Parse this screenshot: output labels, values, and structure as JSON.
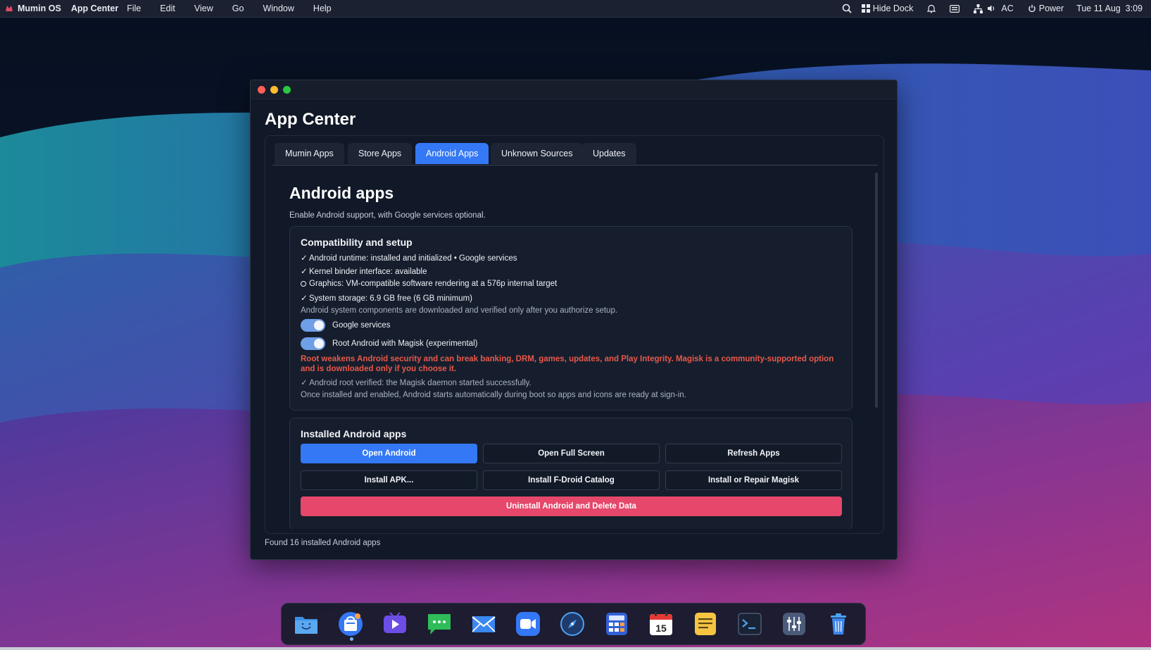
{
  "menubar": {
    "os_name": "Mumin OS",
    "app_name": "App Center",
    "menus": [
      "File",
      "Edit",
      "View",
      "Go",
      "Window",
      "Help"
    ],
    "hide_dock_label": "Hide Dock",
    "audio_label": "AC",
    "power_label": "Power",
    "datetime": "Tue 11 Aug  3:09"
  },
  "window": {
    "title": "App Center",
    "tabs": [
      {
        "label": "Mumin Apps",
        "active": false
      },
      {
        "label": "Store Apps",
        "active": false
      },
      {
        "label": "Android Apps",
        "active": true
      },
      {
        "label": "Unknown Sources",
        "active": false
      },
      {
        "label": "Updates",
        "active": false
      }
    ],
    "section_title": "Android apps",
    "section_subtitle": "Enable Android support, with Google services optional.",
    "compat": {
      "title": "Compatibility and setup",
      "checks": [
        {
          "mark": "✓",
          "text": "Android runtime: installed and initialized • Google services"
        },
        {
          "mark": "✓",
          "text": "Kernel binder interface: available"
        },
        {
          "mark": "circle",
          "text": "Graphics: VM-compatible software rendering at a 576p internal target"
        },
        {
          "mark": "✓",
          "text": "System storage: 6.9 GB free (6 GB minimum)"
        }
      ],
      "note": "Android system components are downloaded and verified only after you authorize setup.",
      "toggle_google": {
        "label": "Google services",
        "on": true
      },
      "toggle_root": {
        "label": "Root Android with Magisk (experimental)",
        "on": true
      },
      "warning": "Root weakens Android security and can break banking, DRM, games, updates, and Play Integrity. Magisk is a community-supported option and is downloaded only if you choose it.",
      "root_verified": "✓ Android root verified: the Magisk daemon started successfully.",
      "boot_note": "Once installed and enabled, Android starts automatically during boot so apps and icons are ready at sign-in."
    },
    "installed": {
      "title": "Installed Android apps",
      "open_android": "Open Android",
      "open_full_screen": "Open Full Screen",
      "refresh_apps": "Refresh Apps",
      "install_apk": "Install APK...",
      "install_fdroid": "Install F-Droid Catalog",
      "install_magisk": "Install or Repair Magisk",
      "uninstall": "Uninstall Android and Delete Data"
    },
    "status": "Found 16 installed Android apps"
  },
  "dock": {
    "items": [
      "finder-icon",
      "app-center-icon",
      "video-player-icon",
      "messages-icon",
      "mail-icon",
      "video-call-icon",
      "browser-compass-icon",
      "calculator-icon",
      "calendar-icon",
      "notes-icon",
      "terminal-icon",
      "settings-sliders-icon",
      "trash-icon"
    ],
    "calendar_day": "15"
  },
  "colors": {
    "accent": "#3478f6",
    "danger": "#e5486a",
    "warning_text": "#e8584a"
  }
}
